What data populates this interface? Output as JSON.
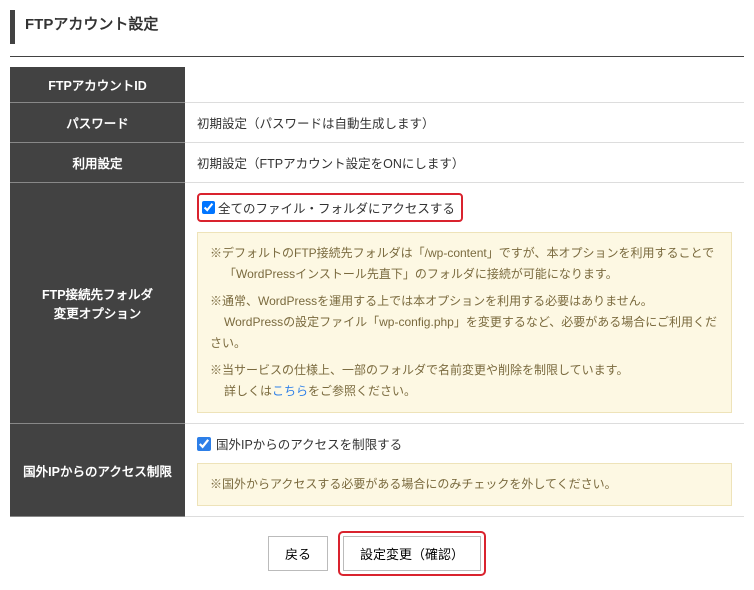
{
  "page_title": "FTPアカウント設定",
  "rows": {
    "account_id_label": "FTPアカウントID",
    "account_id_value": " ",
    "password_label": "パスワード",
    "password_value": "初期設定（パスワードは自動生成します）",
    "usage_label": "利用設定",
    "usage_value": "初期設定（FTPアカウント設定をONにします）",
    "folder_option_label_1": "FTP接続先フォルダ",
    "folder_option_label_2": "変更オプション",
    "folder_checkbox_label": "全てのファイル・フォルダにアクセスする",
    "folder_note_1a": "※デフォルトのFTP接続先フォルダは「/wp-content」ですが、本オプションを利用することで",
    "folder_note_1b": "「WordPressインストール先直下」のフォルダに接続が可能になります。",
    "folder_note_2a": "※通常、WordPressを運用する上では本オプションを利用する必要はありません。",
    "folder_note_2b": "WordPressの設定ファイル「wp-config.php」を変更するなど、必要がある場合にご利用ください。",
    "folder_note_3a": "※当サービスの仕様上、一部のフォルダで名前変更や削除を制限しています。",
    "folder_note_3b_prefix": "詳しくは",
    "folder_note_3b_link": "こちら",
    "folder_note_3b_suffix": "をご参照ください。",
    "foreign_ip_label": "国外IPからのアクセス制限",
    "foreign_ip_checkbox_label": "国外IPからのアクセスを制限する",
    "foreign_ip_note": "※国外からアクセスする必要がある場合にのみチェックを外してください。"
  },
  "buttons": {
    "back": "戻る",
    "confirm": "設定変更（確認）"
  }
}
